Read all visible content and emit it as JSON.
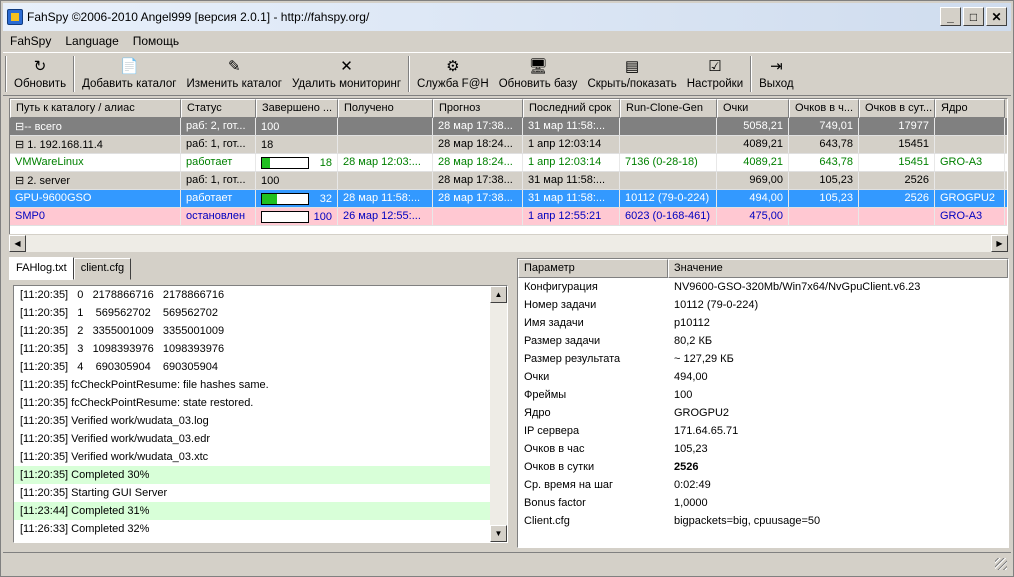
{
  "window": {
    "title": "FahSpy ©2006-2010 Angel999 [версия 2.0.1] - http://fahspy.org/"
  },
  "menu": [
    "FahSpy",
    "Language",
    "Помощь"
  ],
  "toolbar": [
    {
      "label": "Обновить",
      "icon": "refresh-icon"
    },
    {
      "label": "Добавить каталог",
      "icon": "add-folder-icon"
    },
    {
      "label": "Изменить каталог",
      "icon": "edit-folder-icon"
    },
    {
      "label": "Удалить мониторинг",
      "icon": "delete-icon"
    },
    {
      "label": "Служба F@H",
      "icon": "service-icon"
    },
    {
      "label": "Обновить базу",
      "icon": "update-db-icon"
    },
    {
      "label": "Скрыть/показать",
      "icon": "toggle-view-icon"
    },
    {
      "label": "Настройки",
      "icon": "settings-icon"
    },
    {
      "label": "Выход",
      "icon": "exit-icon"
    }
  ],
  "grid": {
    "columns": [
      "Путь к каталогу / алиас",
      "Статус",
      "Завершено ...",
      "Получено",
      "Прогноз",
      "Последний срок",
      "Run-Clone-Gen",
      "Очки",
      "Очков в ч...",
      "Очков в сут...",
      "Ядро"
    ],
    "rows": [
      {
        "tree": "⊟-- всего",
        "status": "раб: 2, гот...",
        "progress_text": "100",
        "progress": 100,
        "received": "",
        "forecast": "28 мар  17:38...",
        "deadline": "31 мар  11:58:...",
        "rcg": "",
        "points": "5058,21",
        "pph": "749,01",
        "ppd": "17977",
        "core": ""
      },
      {
        "tree": "  ⊟ 1. 192.168.11.4",
        "status": "раб: 1, гот...",
        "progress_text": "18",
        "progress": 18,
        "received": "",
        "forecast": "28 мар  18:24...",
        "deadline": "1 апр  12:03:14",
        "rcg": "",
        "points": "4089,21",
        "pph": "643,78",
        "ppd": "15451",
        "core": ""
      },
      {
        "tree": "        VMWareLinux",
        "status": "работает",
        "progress_text": "18",
        "progress": 18,
        "received": "28 мар  12:03:...",
        "forecast": "28 мар  18:24...",
        "deadline": "1 апр  12:03:14",
        "rcg": "7136 (0-28-18)",
        "points": "4089,21",
        "pph": "643,78",
        "ppd": "15451",
        "core": "GRO-A3"
      },
      {
        "tree": "  ⊟ 2. server",
        "status": "раб: 1, гот...",
        "progress_text": "100",
        "progress": 100,
        "received": "",
        "forecast": "28 мар  17:38...",
        "deadline": "31 мар  11:58:...",
        "rcg": "",
        "points": "969,00",
        "pph": "105,23",
        "ppd": "2526",
        "core": ""
      },
      {
        "tree": "        GPU-9600GSO",
        "status": "работает",
        "progress_text": "32",
        "progress": 32,
        "received": "28 мар  11:58:...",
        "forecast": "28 мар  17:38...",
        "deadline": "31 мар  11:58:...",
        "rcg": "10112 (79-0-224)",
        "points": "494,00",
        "pph": "105,23",
        "ppd": "2526",
        "core": "GROGPU2"
      },
      {
        "tree": "        SMP0",
        "status": "остановлен",
        "progress_text": "100",
        "progress": 0,
        "received": "26 мар  12:55:...",
        "forecast": "",
        "deadline": "1 апр  12:55:21",
        "rcg": "6023 (0-168-461)",
        "points": "475,00",
        "pph": "",
        "ppd": "",
        "core": "GRO-A3"
      }
    ]
  },
  "tabs": [
    "FAHlog.txt",
    "client.cfg"
  ],
  "log": [
    {
      "text": "[11:20:35]   0   2178866716   2178866716",
      "hl": false
    },
    {
      "text": "[11:20:35]   1    569562702    569562702",
      "hl": false
    },
    {
      "text": "[11:20:35]   2   3355001009   3355001009",
      "hl": false
    },
    {
      "text": "[11:20:35]   3   1098393976   1098393976",
      "hl": false
    },
    {
      "text": "[11:20:35]   4    690305904    690305904",
      "hl": false
    },
    {
      "text": "[11:20:35] fcCheckPointResume: file hashes same.",
      "hl": false
    },
    {
      "text": "[11:20:35] fcCheckPointResume: state restored.",
      "hl": false
    },
    {
      "text": "[11:20:35] Verified work/wudata_03.log",
      "hl": false
    },
    {
      "text": "[11:20:35] Verified work/wudata_03.edr",
      "hl": false
    },
    {
      "text": "[11:20:35] Verified work/wudata_03.xtc",
      "hl": false
    },
    {
      "text": "[11:20:35] Completed 30%",
      "hl": true
    },
    {
      "text": "[11:20:35] Starting GUI Server",
      "hl": false
    },
    {
      "text": "[11:23:44] Completed 31%",
      "hl": true
    },
    {
      "text": "[11:26:33] Completed 32%",
      "hl": false
    }
  ],
  "params": {
    "columns": [
      "Параметр",
      "Значение"
    ],
    "rows": [
      [
        "Конфигурация",
        "NV9600-GSO-320Mb/Win7x64/NvGpuClient.v6.23"
      ],
      [
        "Номер задачи",
        "10112 (79-0-224)"
      ],
      [
        "Имя задачи",
        "p10112"
      ],
      [
        "Размер задачи",
        "80,2 КБ"
      ],
      [
        "Размер результата",
        "~ 127,29 КБ"
      ],
      [
        "Очки",
        "494,00"
      ],
      [
        "Фреймы",
        "100"
      ],
      [
        "Ядро",
        "GROGPU2"
      ],
      [
        "IP сервера",
        "171.64.65.71"
      ],
      [
        "Очков в час",
        "105,23"
      ],
      [
        "Очков в сутки",
        "2526"
      ],
      [
        "Ср. время на шаг",
        "0:02:49"
      ],
      [
        "Bonus factor",
        "1,0000"
      ],
      [
        "Client.cfg",
        "bigpackets=big, cpuusage=50"
      ]
    ]
  }
}
